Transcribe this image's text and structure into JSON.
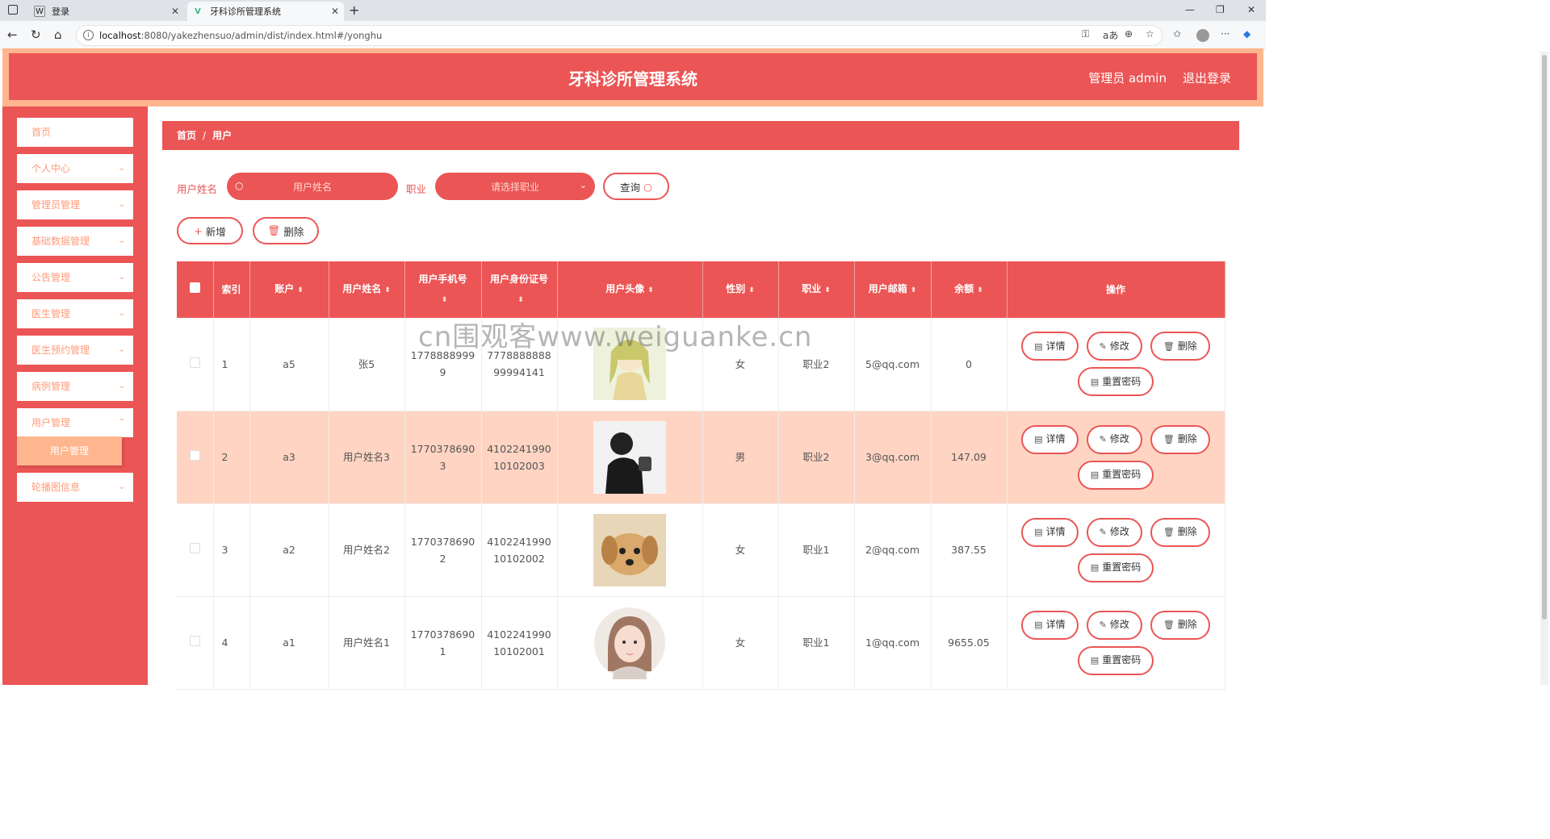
{
  "browser": {
    "tabs": [
      {
        "favicon": "W",
        "label": "登录"
      },
      {
        "favicon": "V",
        "label": "牙科诊所管理系统"
      }
    ],
    "url_host": "localhost",
    "url_rest": ":8080/yakezhensuo/admin/dist/index.html#/yonghu"
  },
  "header": {
    "title": "牙科诊所管理系统",
    "user": "管理员 admin",
    "logout": "退出登录"
  },
  "sidebar": {
    "items": [
      {
        "label": "首页"
      },
      {
        "label": "个人中心"
      },
      {
        "label": "管理员管理"
      },
      {
        "label": "基础数据管理"
      },
      {
        "label": "公告管理"
      },
      {
        "label": "医生管理"
      },
      {
        "label": "医生预约管理"
      },
      {
        "label": "病例管理"
      },
      {
        "label": "用户管理"
      },
      {
        "label": "轮播图信息"
      }
    ],
    "sub_item": "用户管理"
  },
  "breadcrumb": {
    "home": "首页",
    "sep": "/",
    "current": "用户"
  },
  "search": {
    "name_label": "用户姓名",
    "name_placeholder": "用户姓名",
    "job_label": "职业",
    "job_placeholder": "请选择职业",
    "query_button": "查询"
  },
  "actions": {
    "add": "新增",
    "delete": "删除"
  },
  "table": {
    "headers": [
      "索引",
      "账户",
      "用户姓名",
      "用户手机号",
      "用户身份证号",
      "用户头像",
      "性别",
      "职业",
      "用户邮箱",
      "余额",
      "操作"
    ],
    "rows": [
      {
        "index": "1",
        "account": "a5",
        "name": "张5",
        "phone": "17788889999",
        "id_card": "777888888899994141",
        "gender": "女",
        "job": "职业2",
        "email": "5@qq.com",
        "balance": "0",
        "avatar": "girl-anime-avatar"
      },
      {
        "index": "2",
        "account": "a3",
        "name": "用户姓名3",
        "phone": "17703786903",
        "id_card": "410224199010102003",
        "gender": "男",
        "job": "职业2",
        "email": "3@qq.com",
        "balance": "147.09",
        "avatar": "man-silhouette-avatar"
      },
      {
        "index": "3",
        "account": "a2",
        "name": "用户姓名2",
        "phone": "17703786902",
        "id_card": "410224199010102002",
        "gender": "女",
        "job": "职业1",
        "email": "2@qq.com",
        "balance": "387.55",
        "avatar": "puppy-avatar"
      },
      {
        "index": "4",
        "account": "a1",
        "name": "用户姓名1",
        "phone": "17703786901",
        "id_card": "410224199010102001",
        "gender": "女",
        "job": "职业1",
        "email": "1@qq.com",
        "balance": "9655.05",
        "avatar": "girl-illustration-avatar"
      }
    ],
    "row_actions": {
      "detail": "详情",
      "edit": "修改",
      "delete": "删除",
      "reset": "重置密码"
    }
  },
  "watermark": "cn围观客www.weiguanke.cn",
  "colors": {
    "primary": "#eb5555",
    "accent": "#ffb58e",
    "row_highlight": "#ffd4c2"
  }
}
